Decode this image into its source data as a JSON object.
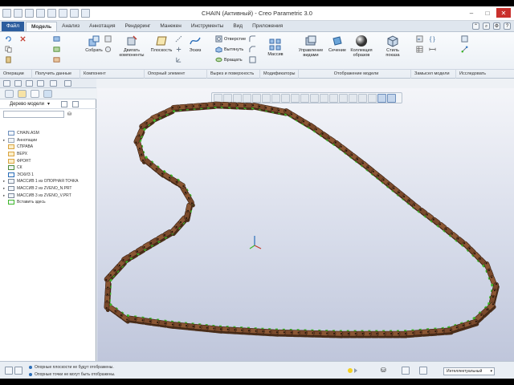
{
  "window": {
    "title": "CHAIN (Активный) - Creo Parametric 3.0"
  },
  "menu_tabs": [
    "Файл",
    "Модель",
    "Анализ",
    "Аннотация",
    "Рендеринг",
    "Манекен",
    "Инструменты",
    "Вид",
    "Приложения"
  ],
  "active_tab": "Модель",
  "ribbon": {
    "assemble": "Собрать",
    "drag": "Двигать\nкомпоненты",
    "plane": "Плоскость",
    "sketch": "Эскиз",
    "hole": "Отверстие",
    "extrude": "Вытянуть",
    "revolve": "Вращать",
    "pattern": "Массив",
    "view_manager": "Управление\nвидами",
    "section": "Сечение",
    "appearance": "Коллекция\nобразов",
    "display_style": "Стиль\nпоказа"
  },
  "ribbon_groups": [
    "Операции",
    "Получить данные",
    "Компонент",
    "Опорный элемент",
    "Вырез и поверхность",
    "Модификаторы",
    "Отображение модели",
    "Замысел модели",
    "Исследовать"
  ],
  "model_tree": {
    "title": "Дерево модели",
    "items": [
      {
        "label": "CHAIN.ASM",
        "icon": "assembly-icon",
        "expander": ""
      },
      {
        "label": "Аннотации",
        "icon": "annotation-icon",
        "expander": "▸"
      },
      {
        "label": "СПРАВА",
        "icon": "datum-plane-icon",
        "expander": ""
      },
      {
        "label": "ВЕРХ",
        "icon": "datum-plane-icon",
        "expander": ""
      },
      {
        "label": "ФРОНТ",
        "icon": "datum-plane-icon",
        "expander": ""
      },
      {
        "label": "СК",
        "icon": "csys-icon",
        "expander": ""
      },
      {
        "label": "ЭСКИЗ 1",
        "icon": "sketch-icon",
        "expander": ""
      },
      {
        "label": "МАССИВ 1 из ОПОРНАЯ ТОЧКА",
        "icon": "pattern-icon",
        "expander": "▸"
      },
      {
        "label": "МАССИВ 2 из ZVENO_N.PRT",
        "icon": "pattern-icon",
        "expander": "▸"
      },
      {
        "label": "МАССИВ 3 из ZVENO_V.PRT",
        "icon": "pattern-icon",
        "expander": "▸"
      },
      {
        "label": "Вставить здесь",
        "icon": "insert-icon",
        "expander": ""
      }
    ]
  },
  "status": {
    "messages": [
      "Опорные плоскости не будут отображены.",
      "Опорные точки не могут быть отображены."
    ],
    "filter": "Интеллектуальный"
  },
  "colors": {
    "chain_link": "#7a4a2c",
    "chain_pin": "#3fb82a",
    "file_tab": "#2c5d9e"
  }
}
